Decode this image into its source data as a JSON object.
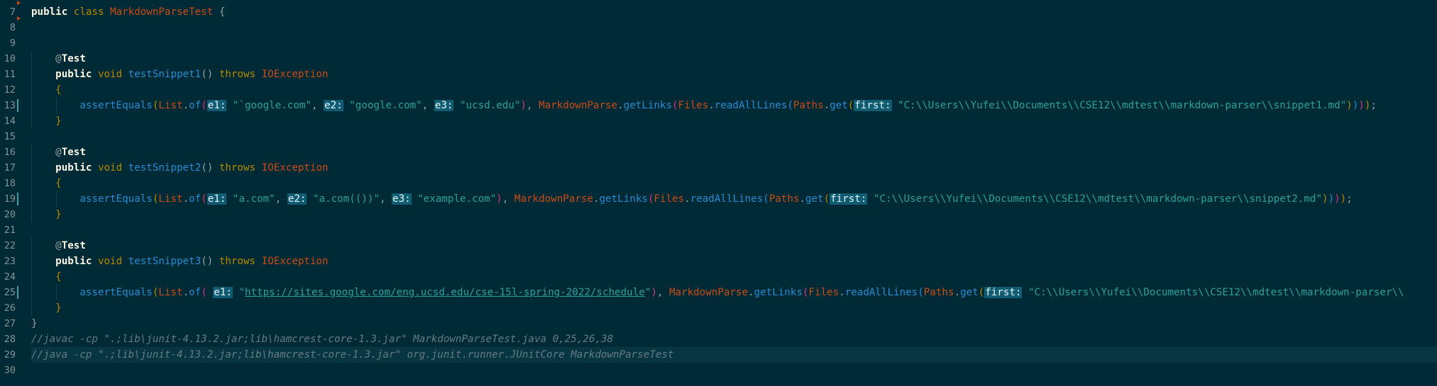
{
  "editor": {
    "lines": [
      {
        "n": "7",
        "segs": [
          [
            "kw",
            "public"
          ],
          [
            "t",
            " "
          ],
          [
            "kw2",
            "class"
          ],
          [
            "t",
            " "
          ],
          [
            "cls",
            "MarkdownParseTest"
          ],
          [
            "t",
            " {"
          ]
        ]
      },
      {
        "n": "8",
        "segs": []
      },
      {
        "n": "9",
        "segs": []
      },
      {
        "n": "10",
        "segs": [
          [
            "t",
            "    "
          ],
          [
            "ann",
            "@"
          ],
          [
            "kw",
            "Test"
          ]
        ]
      },
      {
        "n": "11",
        "segs": [
          [
            "t",
            "    "
          ],
          [
            "kw",
            "public"
          ],
          [
            "t",
            " "
          ],
          [
            "kw2",
            "void"
          ],
          [
            "t",
            " "
          ],
          [
            "fn",
            "testSnippet1"
          ],
          [
            "t",
            "() "
          ],
          [
            "kw2",
            "throws"
          ],
          [
            "t",
            " "
          ],
          [
            "cls",
            "IOException"
          ]
        ]
      },
      {
        "n": "12",
        "segs": [
          [
            "t",
            "    "
          ],
          [
            "br1",
            "{"
          ]
        ]
      },
      {
        "n": "13",
        "segs": [
          [
            "t",
            "        "
          ],
          [
            "fn",
            "assertEquals"
          ],
          [
            "br1",
            "("
          ],
          [
            "cls",
            "List"
          ],
          [
            "t",
            "."
          ],
          [
            "fn",
            "of"
          ],
          [
            "br2",
            "("
          ],
          [
            "hint",
            "e1:"
          ],
          [
            "t",
            " "
          ],
          [
            "str",
            "\"`google.com\""
          ],
          [
            "t",
            ", "
          ],
          [
            "hint",
            "e2:"
          ],
          [
            "t",
            " "
          ],
          [
            "str",
            "\"google.com\""
          ],
          [
            "t",
            ", "
          ],
          [
            "hint",
            "e3:"
          ],
          [
            "t",
            " "
          ],
          [
            "str",
            "\"ucsd.edu\""
          ],
          [
            "br2",
            ")"
          ],
          [
            "t",
            ", "
          ],
          [
            "cls",
            "MarkdownParse"
          ],
          [
            "t",
            "."
          ],
          [
            "fn",
            "getLinks"
          ],
          [
            "br2",
            "("
          ],
          [
            "cls",
            "Files"
          ],
          [
            "t",
            "."
          ],
          [
            "fn",
            "readAllLines"
          ],
          [
            "br3",
            "("
          ],
          [
            "cls",
            "Paths"
          ],
          [
            "t",
            "."
          ],
          [
            "fn",
            "get"
          ],
          [
            "br1",
            "("
          ],
          [
            "hint",
            "first:"
          ],
          [
            "t",
            " "
          ],
          [
            "str",
            "\"C:\\\\Users\\\\Yufei\\\\Documents\\\\CSE12\\\\mdtest\\\\markdown-parser\\\\snippet1.md\""
          ],
          [
            "br1",
            ")"
          ],
          [
            "br3",
            ")"
          ],
          [
            "br2",
            ")"
          ],
          [
            "br1",
            ")"
          ],
          [
            "t",
            ";"
          ]
        ]
      },
      {
        "n": "14",
        "segs": [
          [
            "t",
            "    "
          ],
          [
            "br1",
            "}"
          ]
        ]
      },
      {
        "n": "15",
        "segs": []
      },
      {
        "n": "16",
        "segs": [
          [
            "t",
            "    "
          ],
          [
            "ann",
            "@"
          ],
          [
            "kw",
            "Test"
          ]
        ]
      },
      {
        "n": "17",
        "segs": [
          [
            "t",
            "    "
          ],
          [
            "kw",
            "public"
          ],
          [
            "t",
            " "
          ],
          [
            "kw2",
            "void"
          ],
          [
            "t",
            " "
          ],
          [
            "fn",
            "testSnippet2"
          ],
          [
            "t",
            "() "
          ],
          [
            "kw2",
            "throws"
          ],
          [
            "t",
            " "
          ],
          [
            "cls",
            "IOException"
          ]
        ]
      },
      {
        "n": "18",
        "segs": [
          [
            "t",
            "    "
          ],
          [
            "br1",
            "{"
          ]
        ]
      },
      {
        "n": "19",
        "segs": [
          [
            "t",
            "        "
          ],
          [
            "fn",
            "assertEquals"
          ],
          [
            "br1",
            "("
          ],
          [
            "cls",
            "List"
          ],
          [
            "t",
            "."
          ],
          [
            "fn",
            "of"
          ],
          [
            "br2",
            "("
          ],
          [
            "hint",
            "e1:"
          ],
          [
            "t",
            " "
          ],
          [
            "str",
            "\"a.com\""
          ],
          [
            "t",
            ", "
          ],
          [
            "hint",
            "e2:"
          ],
          [
            "t",
            " "
          ],
          [
            "str",
            "\"a.com(())\""
          ],
          [
            "t",
            ", "
          ],
          [
            "hint",
            "e3:"
          ],
          [
            "t",
            " "
          ],
          [
            "str",
            "\"example.com\""
          ],
          [
            "br2",
            ")"
          ],
          [
            "t",
            ", "
          ],
          [
            "cls",
            "MarkdownParse"
          ],
          [
            "t",
            "."
          ],
          [
            "fn",
            "getLinks"
          ],
          [
            "br2",
            "("
          ],
          [
            "cls",
            "Files"
          ],
          [
            "t",
            "."
          ],
          [
            "fn",
            "readAllLines"
          ],
          [
            "br3",
            "("
          ],
          [
            "cls",
            "Paths"
          ],
          [
            "t",
            "."
          ],
          [
            "fn",
            "get"
          ],
          [
            "br1",
            "("
          ],
          [
            "hint",
            "first:"
          ],
          [
            "t",
            " "
          ],
          [
            "str",
            "\"C:\\\\Users\\\\Yufei\\\\Documents\\\\CSE12\\\\mdtest\\\\markdown-parser\\\\snippet2.md\""
          ],
          [
            "br1",
            ")"
          ],
          [
            "br3",
            ")"
          ],
          [
            "br2",
            ")"
          ],
          [
            "br1",
            ")"
          ],
          [
            "t",
            ";"
          ]
        ]
      },
      {
        "n": "20",
        "segs": [
          [
            "t",
            "    "
          ],
          [
            "br1",
            "}"
          ]
        ]
      },
      {
        "n": "21",
        "segs": []
      },
      {
        "n": "22",
        "segs": [
          [
            "t",
            "    "
          ],
          [
            "ann",
            "@"
          ],
          [
            "kw",
            "Test"
          ]
        ]
      },
      {
        "n": "23",
        "segs": [
          [
            "t",
            "    "
          ],
          [
            "kw",
            "public"
          ],
          [
            "t",
            " "
          ],
          [
            "kw2",
            "void"
          ],
          [
            "t",
            " "
          ],
          [
            "fn",
            "testSnippet3"
          ],
          [
            "t",
            "() "
          ],
          [
            "kw2",
            "throws"
          ],
          [
            "t",
            " "
          ],
          [
            "cls",
            "IOException"
          ]
        ]
      },
      {
        "n": "24",
        "segs": [
          [
            "t",
            "    "
          ],
          [
            "br1",
            "{"
          ]
        ]
      },
      {
        "n": "25",
        "segs": [
          [
            "t",
            "        "
          ],
          [
            "fn",
            "assertEquals"
          ],
          [
            "br1",
            "("
          ],
          [
            "cls",
            "List"
          ],
          [
            "t",
            "."
          ],
          [
            "fn",
            "of"
          ],
          [
            "br2",
            "("
          ],
          [
            "t",
            " "
          ],
          [
            "hint",
            "e1:"
          ],
          [
            "t",
            " "
          ],
          [
            "str",
            "\""
          ],
          [
            "link",
            "https://sites.google.com/eng.ucsd.edu/cse-15l-spring-2022/schedule"
          ],
          [
            "str",
            "\""
          ],
          [
            "br2",
            ")"
          ],
          [
            "t",
            ", "
          ],
          [
            "cls",
            "MarkdownParse"
          ],
          [
            "t",
            "."
          ],
          [
            "fn",
            "getLinks"
          ],
          [
            "br2",
            "("
          ],
          [
            "cls",
            "Files"
          ],
          [
            "t",
            "."
          ],
          [
            "fn",
            "readAllLines"
          ],
          [
            "br3",
            "("
          ],
          [
            "cls",
            "Paths"
          ],
          [
            "t",
            "."
          ],
          [
            "fn",
            "get"
          ],
          [
            "br1",
            "("
          ],
          [
            "hint",
            "first:"
          ],
          [
            "t",
            " "
          ],
          [
            "str",
            "\"C:\\\\Users\\\\Yufei\\\\Documents\\\\CSE12\\\\mdtest\\\\markdown-parser\\\\"
          ]
        ]
      },
      {
        "n": "26",
        "segs": [
          [
            "t",
            "    "
          ],
          [
            "br1",
            "}"
          ]
        ]
      },
      {
        "n": "27",
        "segs": [
          [
            "t",
            "}"
          ]
        ]
      },
      {
        "n": "28",
        "segs": [
          [
            "cmt",
            "//javac -cp \".;lib\\junit-4.13.2.jar;lib\\hamcrest-core-1.3.jar\" MarkdownParseTest.java 0,25,26,38"
          ]
        ]
      },
      {
        "n": "29",
        "segs": [
          [
            "cmt",
            "//java -cp \".;lib\\junit-4.13.2.jar;lib\\hamcrest-core-1.3.jar\" org.junit.runner.JUnitCore MarkdownParseTest"
          ]
        ]
      },
      {
        "n": "30",
        "segs": []
      }
    ]
  },
  "colors": {
    "background": "#002b36",
    "current_line": "#073642",
    "keyword": "#fdf6e3",
    "modifier": "#b58900",
    "type": "#cb4b16",
    "function": "#268bd2",
    "string": "#2aa198",
    "comment": "#657b83",
    "inlay_hint_bg": "#0f5c73"
  }
}
